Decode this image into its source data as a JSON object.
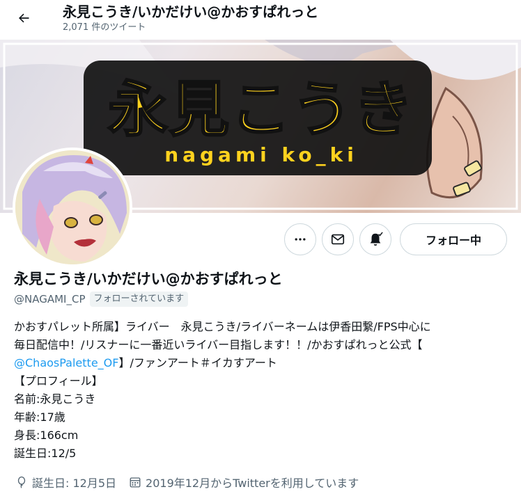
{
  "header": {
    "title": "永見こうき/いかだけい@かおすぱれっと",
    "tweet_count": "2,071 件のツイート"
  },
  "banner": {
    "logo_text": "永見こうき",
    "logo_subtext": "nagami ko_ki"
  },
  "actions": {
    "more_icon": "more-horizontal-icon",
    "message_icon": "envelope-icon",
    "notify_icon": "bell-icon",
    "follow_label": "フォロー中"
  },
  "profile": {
    "display_name": "永見こうき/いかだけい@かおすぱれっと",
    "handle": "@NAGAMI_CP",
    "follows_you": "フォローされています",
    "bio": {
      "line1": "かおすパレット所属】ライバー　永見こうき/ライバーネームは伊香田繋/FPS中心に",
      "line2": "毎日配信中！/リスナーに一番近いライバー目指します！！/かおすぱれっと公式【",
      "line3_mention": "@ChaosPalette_OF",
      "line3_rest": "】/ファンアート＃イカすアート",
      "line4": "【プロフィール】",
      "line5": "名前:永見こうき",
      "line6": "年齢:17歳",
      "line7": "身長:166cm",
      "line8": "誕生日:12/5"
    },
    "birthday": "誕生日: 12月5日",
    "joined": "2019年12月からTwitterを利用しています"
  },
  "colors": {
    "accent": "#1d9bf0",
    "text": "#0f1419",
    "secondary": "#536471",
    "logo_yellow": "#ffd21e"
  }
}
